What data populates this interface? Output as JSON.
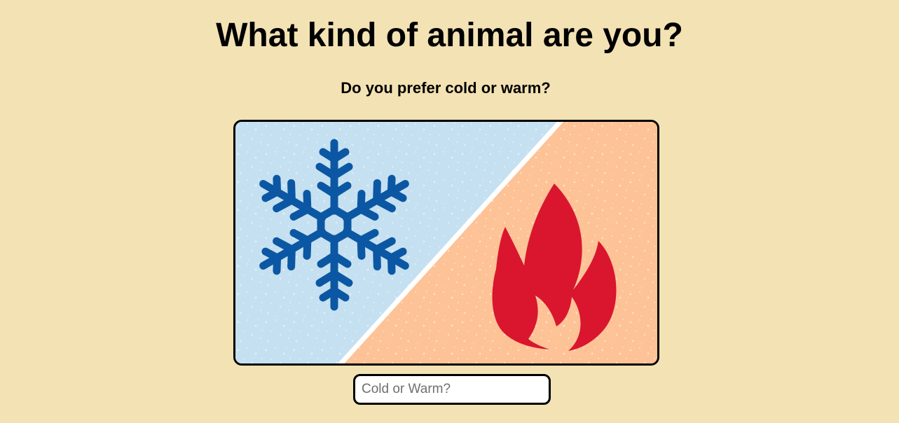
{
  "page": {
    "title": "What kind of animal are you?",
    "question": "Do you prefer cold or warm?"
  },
  "illustration": {
    "left_icon": "snowflake-icon",
    "right_icon": "fire-icon",
    "colors": {
      "cold_background": "#c5e0f0",
      "warm_background": "#fdc296",
      "snowflake": "#0b57a4",
      "flame": "#d9162e"
    }
  },
  "answer": {
    "placeholder": "Cold or Warm?",
    "value": ""
  }
}
